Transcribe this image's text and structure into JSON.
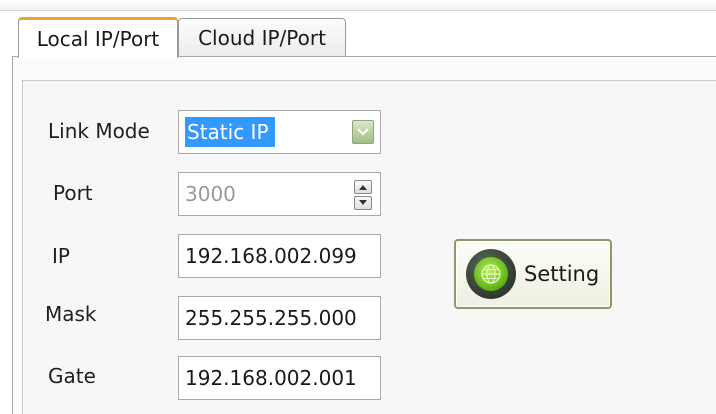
{
  "tabs": [
    {
      "label": "Local IP/Port",
      "active": true
    },
    {
      "label": "Cloud IP/Port",
      "active": false
    }
  ],
  "form": {
    "link_mode": {
      "label": "Link Mode",
      "value": "Static IP"
    },
    "port": {
      "label": "Port",
      "value": "3000"
    },
    "ip": {
      "label": "IP",
      "value": "192.168.002.099"
    },
    "mask": {
      "label": "Mask",
      "value": "255.255.255.000"
    },
    "gate": {
      "label": "Gate",
      "value": "192.168.002.001"
    }
  },
  "setting_button": {
    "label": "Setting"
  },
  "icons": {
    "dropdown": "chevron-down-icon",
    "spin_up": "spin-up-icon",
    "spin_down": "spin-down-icon",
    "setting": "globe-icon"
  },
  "colors": {
    "active_tab_accent": "#f0a030",
    "selection": "#3399ff",
    "button_orb": "#6fbf20"
  }
}
